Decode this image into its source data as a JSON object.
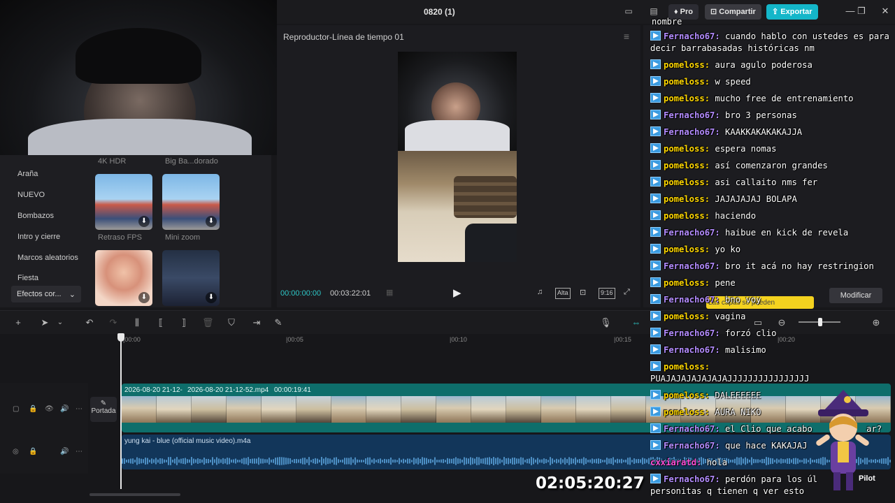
{
  "window": {
    "title": "0820 (1)",
    "pro_label": "Pro",
    "share_label": "Compartir",
    "export_label": "Exportar"
  },
  "media_panel": {
    "categories": [
      "Araña",
      "NUEVO",
      "Bombazos",
      "Intro y cierre",
      "Marcos aleatorios",
      "Fiesta"
    ],
    "effects_select": "Efectos cor...",
    "top_labels": [
      "4K HDR",
      "Big Ba...dorado"
    ],
    "thumbs": [
      "Retraso FPS",
      "Mini zoom"
    ]
  },
  "player": {
    "title": "Reproductor-Línea de tiempo 01",
    "time_current": "00:00:00:00",
    "time_total": "00:03:22:01",
    "ratio_label": "Alta",
    "aspect_label": "9:16"
  },
  "details": {
    "modify_label": "Modificar",
    "tooltip": "Las capas se pueden"
  },
  "timeline": {
    "ticks": [
      "|00:00",
      "|00:05",
      "|00:10",
      "|00:15",
      "|00:20"
    ],
    "cover_label": "Portada",
    "video_clip_1": "2026-08-20 21-12-",
    "video_clip_2": "2026-08-20 21-12-52.mp4",
    "video_clip_duration": "00:00:19:41",
    "audio_clip": "yung kai - blue (official music video).m4a"
  },
  "chat": {
    "top_text": "nombre",
    "messages": [
      {
        "user": "Fernacho67",
        "color": "#b48cff",
        "text": "cuando hablo con ustedes es para",
        "cont": "decir barrabasadas históricas nm"
      },
      {
        "user": "pomeloss",
        "color": "#ffd700",
        "text": "aura agulo poderosa"
      },
      {
        "user": "pomeloss",
        "color": "#ffd700",
        "text": "w speed"
      },
      {
        "user": "pomeloss",
        "color": "#ffd700",
        "text": "mucho free de entrenamiento"
      },
      {
        "user": "Fernacho67",
        "color": "#b48cff",
        "text": "bro 3 personas"
      },
      {
        "user": "Fernacho67",
        "color": "#b48cff",
        "text": "KAAKKAKAKAKAJJA"
      },
      {
        "user": "pomeloss",
        "color": "#ffd700",
        "text": "espera nomas"
      },
      {
        "user": "pomeloss",
        "color": "#ffd700",
        "text": "así comenzaron grandes"
      },
      {
        "user": "pomeloss",
        "color": "#ffd700",
        "text": "asi callaito nms fer"
      },
      {
        "user": "pomeloss",
        "color": "#ffd700",
        "text": "JAJAJAJAJ BOLAPA"
      },
      {
        "user": "pomeloss",
        "color": "#ffd700",
        "text": "haciendo"
      },
      {
        "user": "Fernacho67",
        "color": "#b48cff",
        "text": "haibue en kick de revela"
      },
      {
        "user": "pomeloss",
        "color": "#ffd700",
        "text": "yo ko"
      },
      {
        "user": "Fernacho67",
        "color": "#b48cff",
        "text": "bro it acá no hay restringion"
      },
      {
        "user": "pomeloss",
        "color": "#ffd700",
        "text": "pene"
      },
      {
        "user": "Fernacho67",
        "color": "#b48cff",
        "text": "bno voy"
      },
      {
        "user": "pomeloss",
        "color": "#ffd700",
        "text": "vagina"
      },
      {
        "user": "Fernacho67",
        "color": "#b48cff",
        "text": "forzó clio"
      },
      {
        "user": "Fernacho67",
        "color": "#b48cff",
        "text": "malisimo"
      },
      {
        "user": "pomeloss",
        "color": "#ffd700",
        "text": "",
        "cont": "PUAJAJAJAJAJAJAJJJJJJJJJJJJJJJJ"
      },
      {
        "user": "pomeloss",
        "color": "#ffd700",
        "text": "DALEEEEEE"
      },
      {
        "user": "pomeloss",
        "color": "#ffd700",
        "text": "AURA NIKO"
      },
      {
        "user": "Fernacho67",
        "color": "#b48cff",
        "text": "el Clio que acabo",
        "tail": "ar?"
      },
      {
        "user": "Fernacho67",
        "color": "#b48cff",
        "text": "que hace KAKAJAJ"
      },
      {
        "user": "cxxiaratd",
        "color": "#ff4fd8",
        "text": "hola",
        "nobadge": true
      },
      {
        "user": "Fernacho67",
        "color": "#b48cff",
        "text": "perdón para los úl",
        "cont": "personitas q tienen q ver esto"
      }
    ]
  },
  "overlay": {
    "stream_timer": "02:05:20:27",
    "pilot_label": "Pilot"
  }
}
